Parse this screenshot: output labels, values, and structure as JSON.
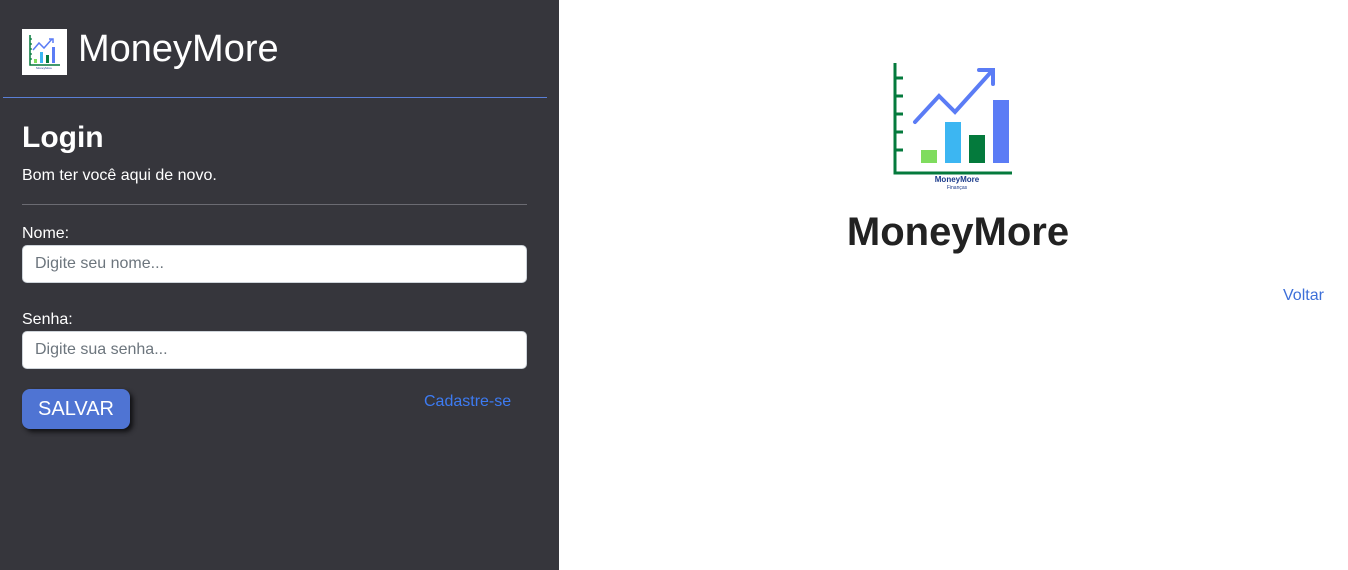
{
  "header": {
    "brand_name": "MoneyMore",
    "logo_icon": "growth-chart-icon"
  },
  "login": {
    "title": "Login",
    "subtitle": "Bom ter você aqui de novo.",
    "name_label": "Nome:",
    "name_placeholder": "Digite seu nome...",
    "name_value": "",
    "password_label": "Senha:",
    "password_placeholder": "Digite sua senha...",
    "password_value": "",
    "save_label": "SALVAR",
    "register_link": "Cadastre-se"
  },
  "hero": {
    "logo_caption": "MoneyMore",
    "logo_subcaption": "Finanças",
    "title": "MoneyMore",
    "back_link": "Voltar"
  },
  "colors": {
    "panel_bg": "#36363c",
    "accent_blue": "#4f74d3",
    "link_blue": "#3d7bf2",
    "chart_green_dark": "#047a3c",
    "chart_green_light": "#7fdc5e",
    "chart_cyan": "#3cb6f2",
    "chart_blue": "#5b7cf5"
  }
}
